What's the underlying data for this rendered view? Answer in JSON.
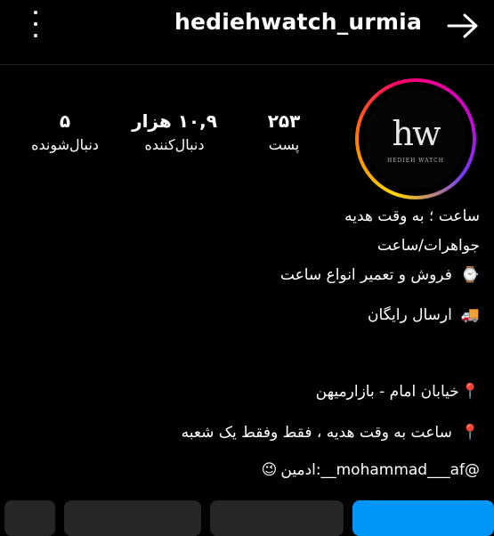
{
  "header": {
    "username": "hediehwatch_urmia",
    "more_icon": "more-vertical-icon",
    "forward_icon": "arrow-right-icon"
  },
  "profile": {
    "logo_letters": "hw",
    "logo_subtitle": "HEDIEH WATCH"
  },
  "stats": {
    "posts": {
      "value": "۲۵۳",
      "label": "پست"
    },
    "followers": {
      "value": "۱۰,۹ هزار",
      "label": "دنبال‌کننده"
    },
    "following": {
      "value": "۵",
      "label": "دنبال‌شونده"
    }
  },
  "bio": {
    "line1": "ساعت ؛ به وقت هدیه",
    "line2": "جواهرات/ساعت",
    "line3": "فروش و تعمیر انواع ساعت",
    "line4": "ارسال رایگان",
    "line5": "خیابان امام  -  بازارمیهن",
    "line6": "ساعت به وقت هدیه ، فقط وفقط یک شعبه",
    "line7": "@mohammad___af__:ادمین",
    "icons": {
      "watch": "⌚",
      "truck": "🚚",
      "pin": "📍",
      "smile": "😉"
    }
  },
  "colors": {
    "background": "#000000",
    "primary_button": "#0095f6",
    "secondary_button": "#262626"
  }
}
